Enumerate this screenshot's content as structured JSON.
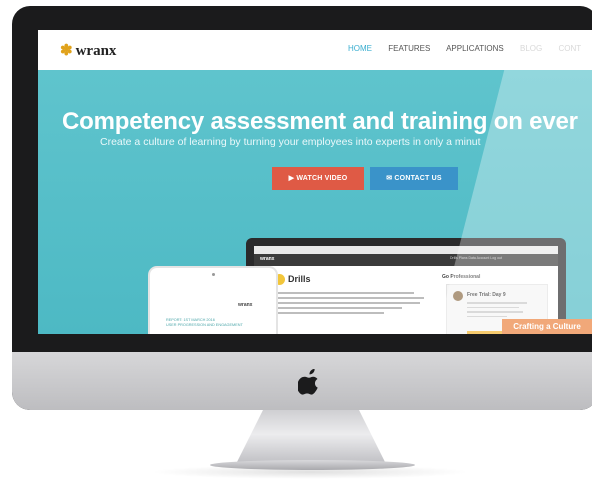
{
  "nav": {
    "logo": "wranx",
    "links": [
      "HOME",
      "FEATURES",
      "APPLICATIONS",
      "BLOG",
      "CONT"
    ]
  },
  "hero": {
    "title": "Competency assessment and training on ever",
    "subtitle": "Create a culture of learning by turning your employees into experts in only a minut",
    "watch_button": "▶ WATCH VIDEO",
    "contact_button": "✉ CONTACT US"
  },
  "laptop": {
    "logo": "wranx",
    "menu": "Drills   Plans   Data   Account   Log out",
    "drills_title": "Drills",
    "go_pro": "Go Professional",
    "trial_title": "Free Trial: Day 9"
  },
  "tablet": {
    "logo": "wranx",
    "report": "REPORT: 1ST MARCH 2016\nUSER PROGRESSION AND ENGAGEMENT"
  },
  "banner": "Crafting a Culture",
  "colors": {
    "hero_bg": "#5ac0c9",
    "watch_button": "#df5a45",
    "contact_button": "#3a93c9",
    "nav_active": "#3aaed0",
    "banner": "#eb7f3a"
  }
}
